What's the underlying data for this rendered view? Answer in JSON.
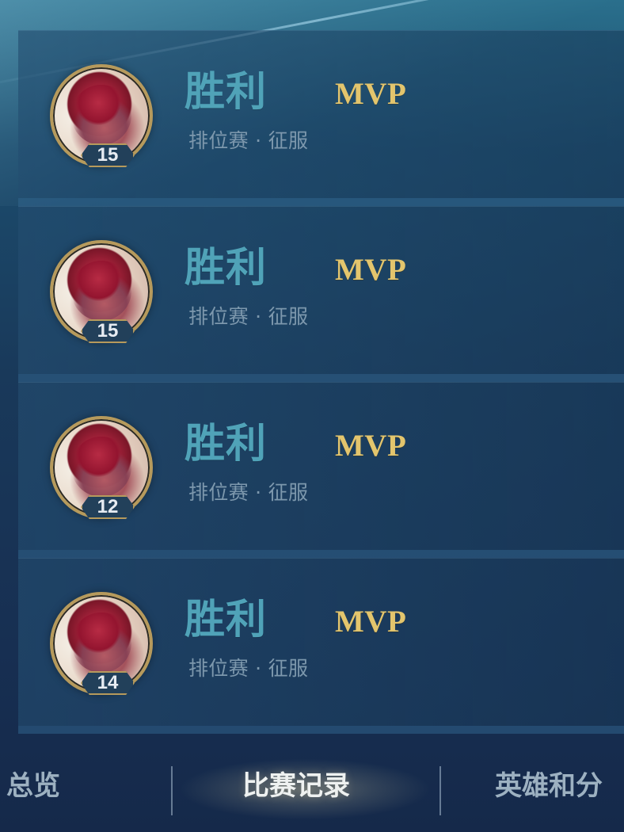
{
  "matches": [
    {
      "result": "胜利",
      "badge": "MVP",
      "mode": "排位赛 · 征服",
      "level": "15"
    },
    {
      "result": "胜利",
      "badge": "MVP",
      "mode": "排位赛 · 征服",
      "level": "15"
    },
    {
      "result": "胜利",
      "badge": "MVP",
      "mode": "排位赛 · 征服",
      "level": "12"
    },
    {
      "result": "胜利",
      "badge": "MVP",
      "mode": "排位赛 · 征服",
      "level": "14"
    }
  ],
  "tabs": {
    "overview": "总览",
    "match_history": "比赛记录",
    "heroes": "英雄和分"
  },
  "colors": {
    "result_text": "#50a3b8",
    "mvp_text": "#e3c56d",
    "mode_text": "#7d98ad"
  }
}
